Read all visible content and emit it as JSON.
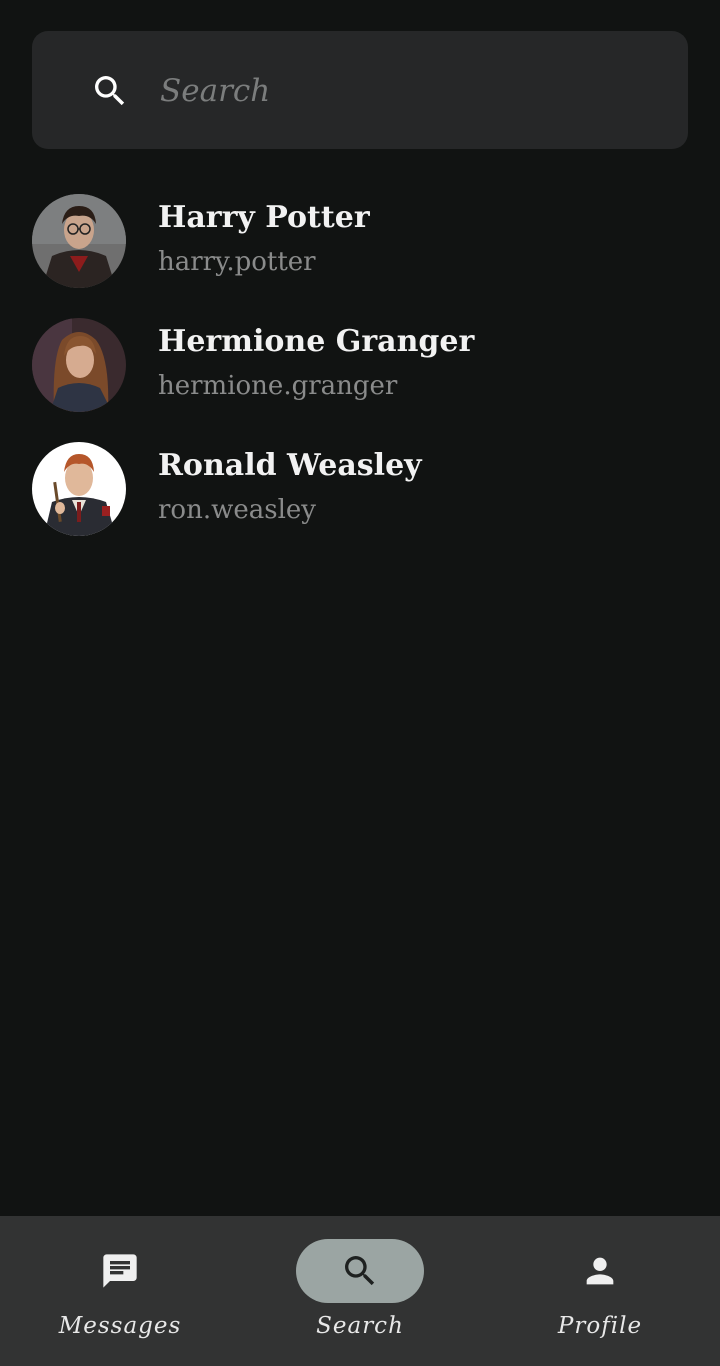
{
  "search": {
    "placeholder": "Search",
    "value": ""
  },
  "results": [
    {
      "name": "Harry Potter",
      "username": "harry.potter"
    },
    {
      "name": "Hermione Granger",
      "username": "hermione.granger"
    },
    {
      "name": "Ronald Weasley",
      "username": "ron.weasley"
    }
  ],
  "nav": {
    "items": [
      {
        "label": "Messages",
        "icon": "message-icon",
        "active": false
      },
      {
        "label": "Search",
        "icon": "search-icon",
        "active": true
      },
      {
        "label": "Profile",
        "icon": "person-icon",
        "active": false
      }
    ]
  },
  "colors": {
    "background": "#111312",
    "search_bar": "#262728",
    "nav_bar": "#323333",
    "active_pill": "#9ba5a3"
  }
}
